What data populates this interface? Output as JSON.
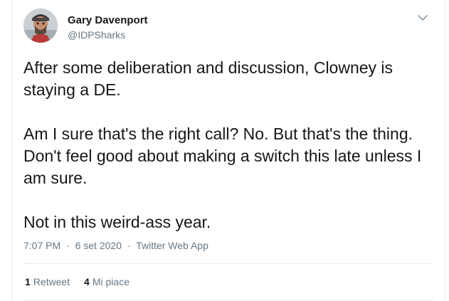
{
  "user": {
    "display_name": "Gary Davenport",
    "handle": "@IDPSharks"
  },
  "tweet": {
    "paragraphs": [
      "After some deliberation and discussion, Clowney is\nstaying a DE.",
      "Am I sure that's the right call? No. But that's the thing.\nDon't feel good about making a switch this late unless I\nam sure.",
      "Not in this weird-ass year."
    ]
  },
  "meta": {
    "time": "7:07 PM",
    "separator": "·",
    "date": "6 set 2020",
    "source": "Twitter Web App"
  },
  "stats": {
    "retweets_count": "1",
    "retweets_label": "Retweet",
    "likes_count": "4",
    "likes_label": "Mi piace"
  },
  "icons": {
    "menu": "chevron-down-icon"
  },
  "colors": {
    "text": "#14171a",
    "secondary": "#657786",
    "border": "#e6ecf0"
  }
}
